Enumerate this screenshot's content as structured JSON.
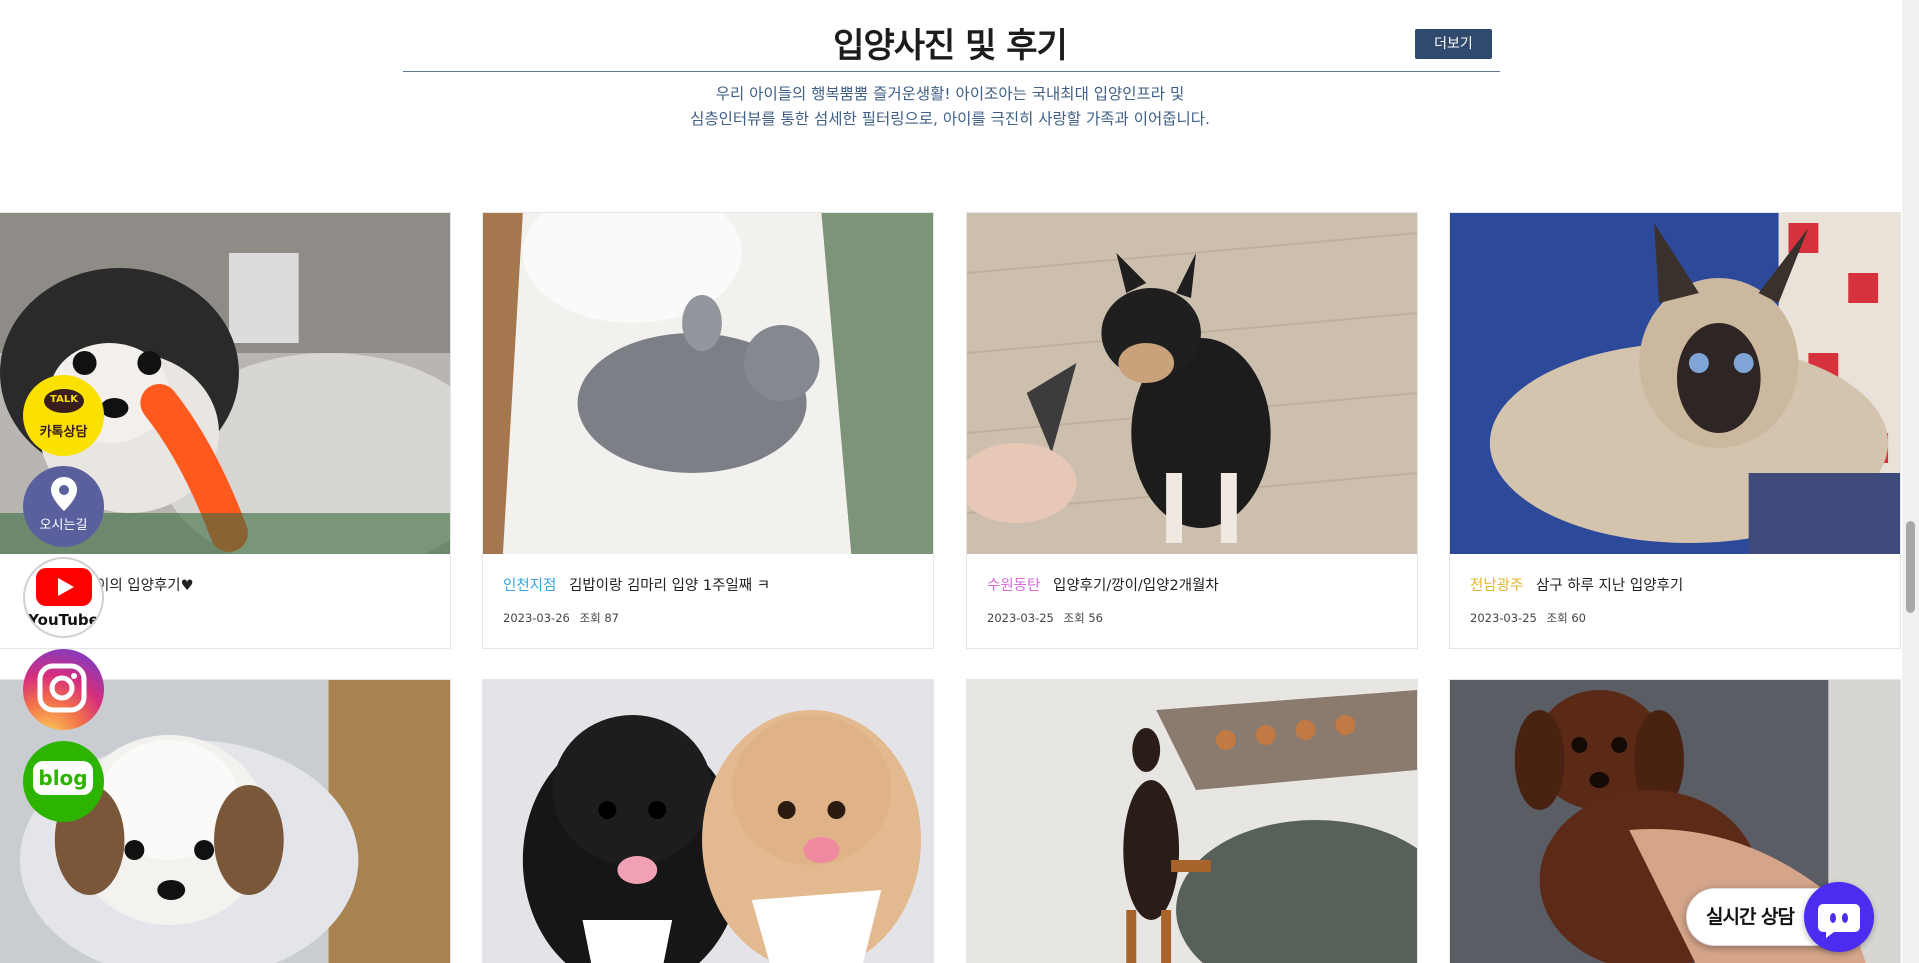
{
  "section": {
    "title": "입양사진 및 후기",
    "more_label": "더보기",
    "desc_line1": "우리 아이들의 행복뿜뿜 즐거운생활! 아이조아는 국내최대 입양인프라 및",
    "desc_line2": "심층인터뷰를 통한 섬세한 필터링으로, 아이를 극진히 사랑할 가족과 이어줍니다."
  },
  "reviews": [
    {
      "branch": "",
      "title": "이의 입양후기♥",
      "date": "",
      "views": ""
    },
    {
      "branch": "인천지점",
      "branch_color": "#37a6de",
      "title": "김밥이랑 김마리 입양 1주일째 ㅋ",
      "date": "2023-03-26",
      "views": "조회 87"
    },
    {
      "branch": "수원동탄",
      "branch_color": "#d66bd6",
      "title": "입양후기/깡이/입양2개월차",
      "date": "2023-03-25",
      "views": "조회 56"
    },
    {
      "branch": "전남광주",
      "branch_color": "#e3b32c",
      "title": "삼구 하루 지난 입양후기",
      "date": "2023-03-25",
      "views": "조회 60"
    }
  ],
  "side_buttons": {
    "kakao_label": "카톡상담",
    "kakao_badge": "TALK",
    "location_label": "오시는길",
    "youtube_label": "YouTube",
    "blog_label": "blog"
  },
  "live_chat": {
    "label": "실시간 상담"
  },
  "colors": {
    "accent_navy": "#2f4a6d",
    "kakao_yellow": "#fae100",
    "blog_green": "#2db400",
    "chat_purple": "#4d2cf2"
  }
}
